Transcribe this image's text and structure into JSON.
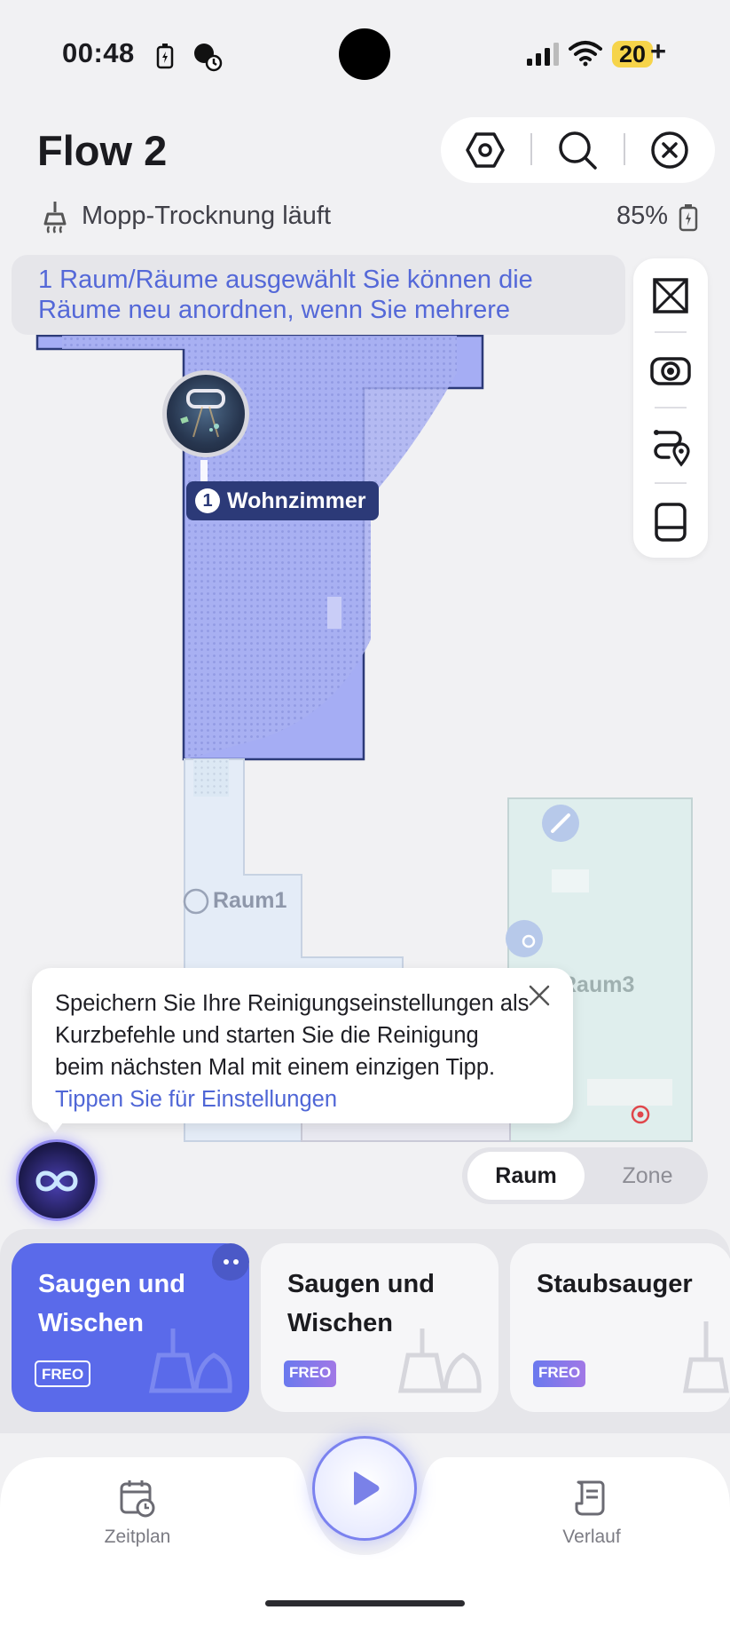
{
  "status_bar": {
    "time": "00:48",
    "battery_level": "20",
    "battery_plus": "+"
  },
  "header": {
    "title": "Flow 2",
    "icons": [
      "settings-hex-icon",
      "search-icon",
      "close-circle-icon"
    ]
  },
  "status": {
    "text": "Mopp-Trocknung läuft",
    "battery": "85%"
  },
  "banner": {
    "text": "1 Raum/Räume ausgewählt Sie können die Räume neu anordnen, wenn Sie mehrere"
  },
  "toolbar": {
    "icons": [
      "room-edit-icon",
      "camera-view-icon",
      "route-pin-icon",
      "dock-station-icon"
    ]
  },
  "map": {
    "rooms": [
      {
        "number": "1",
        "name": "Wohnzimmer"
      },
      {
        "name": "Raum1"
      },
      {
        "name": "Raum3"
      }
    ]
  },
  "tip": {
    "text": "Speichern Sie Ihre Reinigungseinstellungen als Kurzbefehle und starten Sie die Reinigung beim nächsten Mal mit einem einzigen Tipp.",
    "link": "Tippen Sie für Einstellungen"
  },
  "segment": {
    "active": "Raum",
    "inactive": "Zone"
  },
  "modes": [
    {
      "title": "Saugen und Wischen",
      "badge": "FREO",
      "selected": true
    },
    {
      "title": "Saugen und Wischen",
      "badge": "FREO",
      "selected": false
    },
    {
      "title": "Staubsauger",
      "badge": "FREO",
      "selected": false
    }
  ],
  "nav": {
    "left": "Zeitplan",
    "right": "Verlauf"
  },
  "colors": {
    "accent": "#5566e8",
    "room_selected": "#a7aff5",
    "room_outline": "#2c3a78",
    "link": "#4f66d6"
  }
}
